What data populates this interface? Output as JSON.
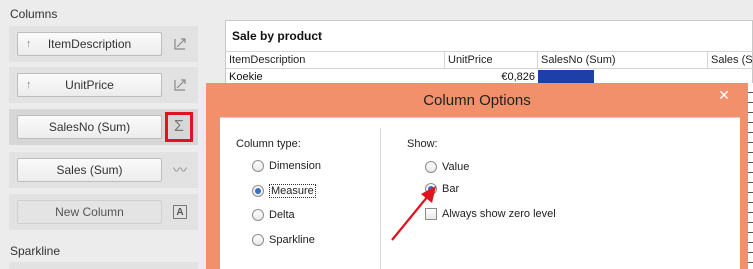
{
  "left_panel": {
    "columns_label": "Columns",
    "items": [
      {
        "label": "ItemDescription",
        "arrow": "↑",
        "icon": "sort-toggle-icon"
      },
      {
        "label": "UnitPrice",
        "arrow": "↑",
        "icon": "sort-toggle-icon"
      },
      {
        "label": "SalesNo (Sum)",
        "icon": "sum-icon",
        "symbol": "Σ"
      },
      {
        "label": "Sales (Sum)",
        "icon": "sparkline-wave-icon",
        "symbol": "〰"
      },
      {
        "label": "New Column",
        "icon": "text-a-icon",
        "symbol": "A"
      }
    ],
    "sparkline_label": "Sparkline"
  },
  "grid": {
    "title": "Sale by product",
    "headers": [
      "ItemDescription",
      "UnitPrice",
      "SalesNo (Sum)",
      "Sales (S"
    ],
    "row1": {
      "item": "Koekie",
      "price": "€0,826"
    }
  },
  "dialog": {
    "title": "Column Options",
    "close": "✕",
    "column_type_label": "Column type:",
    "column_types": [
      "Dimension",
      "Measure",
      "Delta",
      "Sparkline"
    ],
    "selected_type": "Measure",
    "show_label": "Show:",
    "show_options": [
      "Value",
      "Bar"
    ],
    "selected_show": "Bar",
    "zero_level_label": "Always show zero level",
    "zero_level_checked": false
  },
  "colors": {
    "accent_title": "#f1906b",
    "bar": "#1d3fa8",
    "highlight": "#e0141e"
  }
}
